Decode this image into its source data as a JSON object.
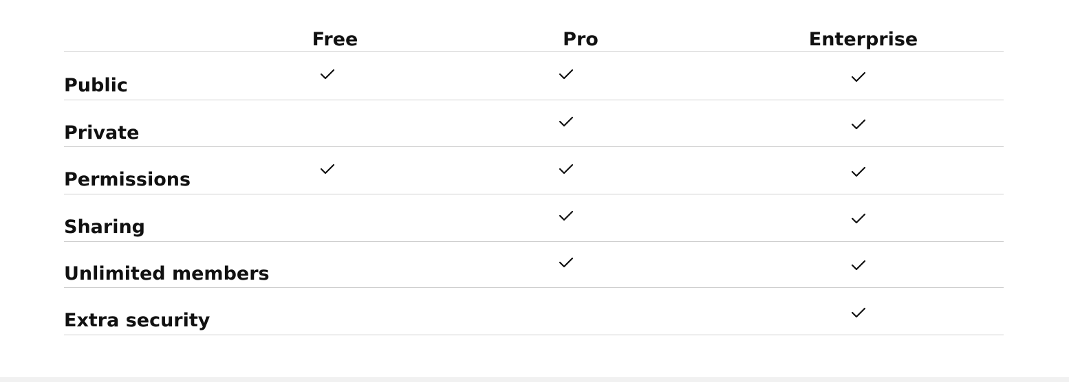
{
  "columns": [
    "Free",
    "Pro",
    "Enterprise"
  ],
  "rows": [
    {
      "label": "Public",
      "checks": [
        true,
        true,
        true
      ]
    },
    {
      "label": "Private",
      "checks": [
        false,
        true,
        true
      ]
    },
    {
      "label": "Permissions",
      "checks": [
        true,
        true,
        true
      ]
    },
    {
      "label": "Sharing",
      "checks": [
        false,
        true,
        true
      ]
    },
    {
      "label": "Unlimited members",
      "checks": [
        false,
        true,
        true
      ]
    },
    {
      "label": "Extra security",
      "checks": [
        false,
        false,
        true
      ]
    }
  ],
  "icons": {
    "check": "check-icon"
  },
  "colors": {
    "text": "#111111",
    "divider": "#cfcfcf",
    "background": "#ffffff"
  }
}
